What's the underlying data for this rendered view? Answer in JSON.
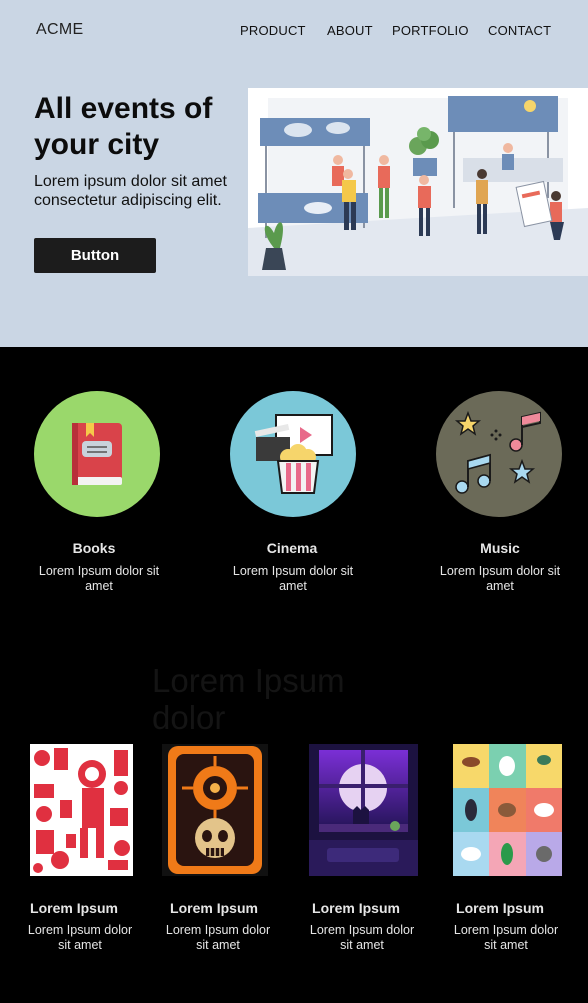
{
  "brand": {
    "logo": "ACME"
  },
  "nav": {
    "items": [
      "PRODUCT",
      "ABOUT",
      "PORTFOLIO",
      "CONTACT"
    ]
  },
  "hero": {
    "title": "All events of your city",
    "subtitle": "Lorem ipsum dolor sit amet consectetur adipiscing elit.",
    "button_label": "Button"
  },
  "categories": [
    {
      "title": "Books",
      "desc": "Lorem Ipsum dolor sit amet",
      "icon": "book-icon",
      "color": "#9ad86b"
    },
    {
      "title": "Cinema",
      "desc": "Lorem Ipsum dolor sit amet",
      "icon": "cinema-icon",
      "color": "#7bc8d8"
    },
    {
      "title": "Music",
      "desc": "Lorem Ipsum dolor sit amet",
      "icon": "music-icon",
      "color": "#6b6a58"
    }
  ],
  "gallery": {
    "title": "Lorem Ipsum dolor",
    "items": [
      {
        "title": "Lorem Ipsum",
        "desc": "Lorem Ipsum dolor sit amet"
      },
      {
        "title": "Lorem Ipsum",
        "desc": "Lorem Ipsum dolor sit amet"
      },
      {
        "title": "Lorem Ipsum",
        "desc": "Lorem Ipsum dolor sit amet"
      },
      {
        "title": "Lorem Ipsum",
        "desc": "Lorem Ipsum dolor sit amet"
      }
    ]
  }
}
